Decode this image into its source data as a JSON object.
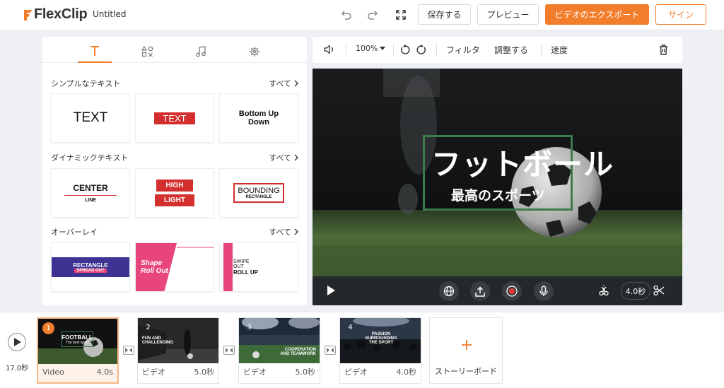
{
  "app": {
    "brand": "FlexClip",
    "project_title": "Untitled",
    "accent": "#f27d2b"
  },
  "header": {
    "undo_icon": "undo-icon",
    "redo_icon": "redo-icon",
    "fullscreen_icon": "fullscreen-icon",
    "save_label": "保存する",
    "preview_label": "プレビュー",
    "export_label": "ビデオのエクスポート",
    "signin_label": "サイン"
  },
  "left_panel": {
    "tabs": [
      {
        "icon": "text-icon",
        "active": true
      },
      {
        "icon": "elements-icon",
        "active": false
      },
      {
        "icon": "music-icon",
        "active": false
      },
      {
        "icon": "settings-icon",
        "active": false
      }
    ],
    "sections": [
      {
        "title": "シンプルなテキスト",
        "see_all": "すべて",
        "cards": [
          {
            "lines": [
              "TEXT"
            ]
          },
          {
            "lines": [
              "TEXT"
            ]
          },
          {
            "lines": [
              "Bottom Up",
              "Down"
            ]
          }
        ]
      },
      {
        "title": "ダイナミックテキスト",
        "see_all": "すべて",
        "cards": [
          {
            "lines": [
              "CENTER",
              "LINE"
            ]
          },
          {
            "lines": [
              "HIGH",
              "LIGHT"
            ]
          },
          {
            "lines": [
              "BOUNDING",
              "RECTANGLE"
            ]
          }
        ]
      },
      {
        "title": "オーバーレイ",
        "see_all": "すべて",
        "cards": [
          {
            "lines": [
              "RECTANGLE",
              "SPREAD OUT"
            ]
          },
          {
            "lines": [
              "Shape",
              "Roll Out"
            ]
          },
          {
            "lines": [
              "SWIPE",
              "OUT",
              "ROLL UP"
            ]
          }
        ]
      }
    ]
  },
  "preview_toolbar": {
    "volume_icon": "volume-icon",
    "zoom": "100%",
    "rotate_left_icon": "rotate-left-icon",
    "rotate_right_icon": "rotate-right-icon",
    "filter_label": "フィルタ",
    "adjust_label": "調整する",
    "speed_label": "速度",
    "delete_icon": "trash-icon"
  },
  "canvas": {
    "title": "フットボール",
    "subtitle": "最高のスポーツ",
    "frame_color": "#3e7a4a"
  },
  "controls": {
    "play_icon": "play-icon",
    "globe_icon": "globe-icon",
    "upload_icon": "upload-icon",
    "record_icon": "record-icon",
    "mic_icon": "mic-icon",
    "split_icon": "split-icon",
    "duration": "4.0秒",
    "scissors_icon": "scissors-icon"
  },
  "timeline": {
    "total": "17.0秒",
    "clips": [
      {
        "num": "1",
        "overlay": [
          "FOOTBALL",
          "The best sport"
        ],
        "name": "Video",
        "dur": "4.0s",
        "active": true
      },
      {
        "num": "2",
        "overlay": [
          "FUN AND",
          "CHALLENGING"
        ],
        "name": "ビデオ",
        "dur": "5.0秒",
        "active": false
      },
      {
        "num": "3",
        "overlay": [
          "COOPERATION",
          "AND TEAMWORK"
        ],
        "name": "ビデオ",
        "dur": "5.0秒",
        "active": false
      },
      {
        "num": "4",
        "overlay": [
          "PASSION",
          "SURROUNDING",
          "THE SPORT"
        ],
        "name": "ビデオ",
        "dur": "4.0秒",
        "active": false
      }
    ],
    "storyboard_label": "ストーリーボード"
  }
}
